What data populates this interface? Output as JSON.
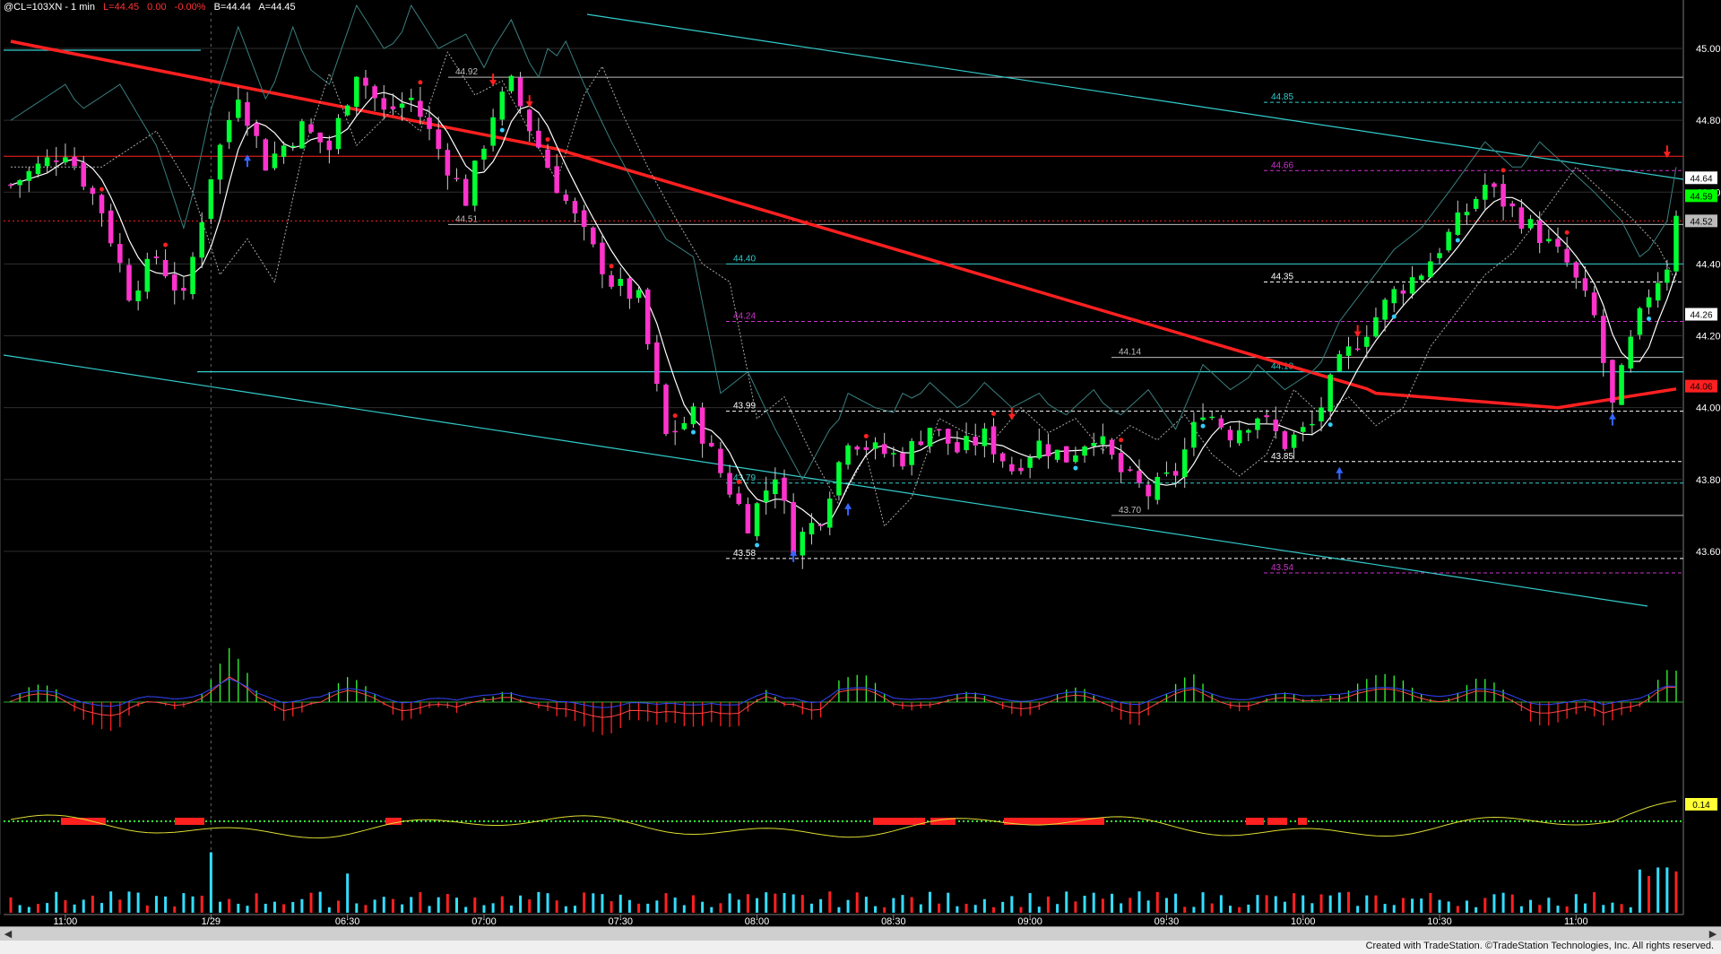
{
  "header": {
    "symbol": "@CL=103XN - 1 min",
    "last": "L=44.45",
    "change": "0.00",
    "pct": "-0.00%",
    "bid": "B=44.44",
    "ask": "A=44.45"
  },
  "footer": {
    "credit": "Created with TradeStation. ©TradeStation Technologies, Inc. All rights reserved."
  },
  "colors": {
    "background": "#000000",
    "up_candle": "#00ff33",
    "down_candle": "#ff33cc",
    "ma_long": "#ff2020",
    "ma_short": "#ffffff",
    "trendline": "#33cccc",
    "pivot_magenta": "#cc33cc"
  },
  "chart_data": [
    {
      "type": "candlestick",
      "ylim": [
        43.45,
        45.1
      ],
      "yticks": [
        "45.00",
        "44.80",
        "44.60",
        "44.40",
        "44.20",
        "44.00",
        "43.80",
        "43.60"
      ],
      "xticks": [
        "11:00",
        "1/29",
        "06:30",
        "07:00",
        "07:30",
        "08:00",
        "08:30",
        "09:00",
        "09:30",
        "10:00",
        "10:30",
        "11:00"
      ],
      "price_badges": [
        {
          "label": "44.64",
          "value": 44.64,
          "color": "#ffffff"
        },
        {
          "label": "44.59",
          "value": 44.59,
          "color": "#00ff00"
        },
        {
          "label": "44.52",
          "value": 44.52,
          "color": "#bbbbbb"
        },
        {
          "label": "44.26",
          "value": 44.26,
          "color": "#ffffff"
        },
        {
          "label": "44.06",
          "value": 44.06,
          "color": "#ff2020"
        }
      ],
      "horizontal_levels": [
        {
          "label": "44.92",
          "value": 44.92,
          "color": "#bbbbbb",
          "style": "solid"
        },
        {
          "label": "44.85",
          "value": 44.85,
          "color": "#33cccc",
          "style": "dashed"
        },
        {
          "label": "44.66",
          "value": 44.66,
          "color": "#cc33cc",
          "style": "dashed"
        },
        {
          "label": "44.51",
          "value": 44.51,
          "color": "#bbbbbb",
          "style": "solid"
        },
        {
          "label": "44.40",
          "value": 44.4,
          "color": "#33cccc",
          "style": "solid"
        },
        {
          "label": "44.35",
          "value": 44.35,
          "color": "#ffffff",
          "style": "dashed"
        },
        {
          "label": "44.24",
          "value": 44.24,
          "color": "#cc33cc",
          "style": "dashed"
        },
        {
          "label": "44.14",
          "value": 44.14,
          "color": "#bbbbbb",
          "style": "solid"
        },
        {
          "label": "44.10",
          "value": 44.1,
          "color": "#33cccc",
          "style": "solid"
        },
        {
          "label": "43.99",
          "value": 43.99,
          "color": "#ffffff",
          "style": "dashed"
        },
        {
          "label": "43.85",
          "value": 43.85,
          "color": "#ffffff",
          "style": "dashed"
        },
        {
          "label": "43.79",
          "value": 43.79,
          "color": "#33cccc",
          "style": "dashed"
        },
        {
          "label": "43.70",
          "value": 43.7,
          "color": "#bbbbbb",
          "style": "solid"
        },
        {
          "label": "43.58",
          "value": 43.58,
          "color": "#ffffff",
          "style": "dashed"
        },
        {
          "label": "43.54",
          "value": 43.54,
          "color": "#cc33cc",
          "style": "dashed"
        }
      ],
      "red_level": 44.7,
      "price_path": [
        [
          0,
          44.62
        ],
        [
          6,
          44.72
        ],
        [
          10,
          44.55
        ],
        [
          13,
          44.32
        ],
        [
          16,
          44.42
        ],
        [
          19,
          44.3
        ],
        [
          22,
          44.65
        ],
        [
          25,
          44.88
        ],
        [
          28,
          44.68
        ],
        [
          32,
          44.78
        ],
        [
          35,
          44.72
        ],
        [
          38,
          44.94
        ],
        [
          41,
          44.82
        ],
        [
          44,
          44.86
        ],
        [
          47,
          44.72
        ],
        [
          50,
          44.58
        ],
        [
          53,
          44.82
        ],
        [
          55,
          44.9
        ],
        [
          57,
          44.78
        ],
        [
          60,
          44.62
        ],
        [
          63,
          44.48
        ],
        [
          66,
          44.35
        ],
        [
          69,
          44.3
        ],
        [
          72,
          43.92
        ],
        [
          75,
          43.98
        ],
        [
          78,
          43.82
        ],
        [
          81,
          43.68
        ],
        [
          84,
          43.82
        ],
        [
          86,
          43.62
        ],
        [
          89,
          43.7
        ],
        [
          92,
          43.92
        ],
        [
          95,
          43.88
        ],
        [
          98,
          43.86
        ],
        [
          101,
          43.95
        ],
        [
          104,
          43.88
        ],
        [
          107,
          43.92
        ],
        [
          110,
          43.83
        ],
        [
          113,
          43.9
        ],
        [
          116,
          43.86
        ],
        [
          119,
          43.93
        ],
        [
          122,
          43.82
        ],
        [
          125,
          43.76
        ],
        [
          128,
          43.82
        ],
        [
          131,
          44.0
        ],
        [
          134,
          43.93
        ],
        [
          137,
          43.98
        ],
        [
          140,
          43.9
        ],
        [
          143,
          43.95
        ],
        [
          146,
          44.12
        ],
        [
          149,
          44.22
        ],
        [
          152,
          44.32
        ],
        [
          155,
          44.38
        ],
        [
          158,
          44.48
        ],
        [
          162,
          44.62
        ],
        [
          165,
          44.55
        ],
        [
          168,
          44.48
        ],
        [
          171,
          44.4
        ],
        [
          174,
          44.25
        ],
        [
          176,
          44.0
        ],
        [
          178,
          44.18
        ],
        [
          180,
          44.32
        ],
        [
          182,
          44.4
        ],
        [
          183,
          44.55
        ]
      ],
      "n_bars": 184
    },
    {
      "type": "bar",
      "name": "oscillator-histogram",
      "ylim": [
        -1,
        1
      ],
      "values_note": "shape follows price momentum"
    },
    {
      "type": "line",
      "name": "lower-indicator",
      "badge": "0.14"
    },
    {
      "type": "bar",
      "name": "volume"
    }
  ]
}
